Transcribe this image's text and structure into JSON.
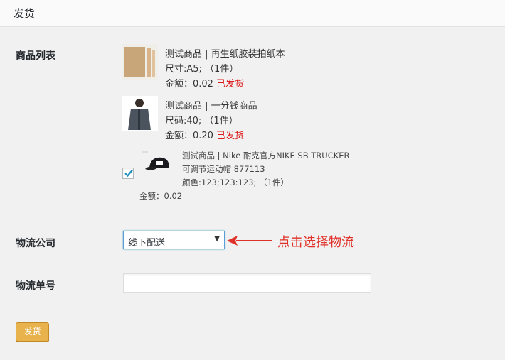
{
  "header": {
    "title": "发货"
  },
  "labels": {
    "product_list": "商品列表",
    "logistics_company": "物流公司",
    "tracking_number": "物流单号"
  },
  "products": [
    {
      "name": "测试商品 | 再生纸胶装拍纸本",
      "spec": "尺寸:A5; （1件）",
      "amount": "金额：0.02",
      "status": "已发货"
    },
    {
      "name": "测试商品 | 一分钱商品",
      "spec": "尺码:40; （1件）",
      "amount": "金额：0.20",
      "status": "已发货"
    },
    {
      "name_line1": "测试商品 | Nike 耐克官方NIKE SB TRUCKER",
      "name_line2": "可调节运动帽 877113",
      "spec": "颜色:123;123:123; （1件）",
      "amount": "金额：0.02",
      "checked": true
    }
  ],
  "logistics": {
    "selected": "线下配送",
    "hint": "点击选择物流"
  },
  "tracking": {
    "value": ""
  },
  "actions": {
    "ship_label": "发货"
  },
  "colors": {
    "status_red": "#dd1a1a",
    "hint_red": "#e0322a",
    "button": "#e8b24d"
  }
}
